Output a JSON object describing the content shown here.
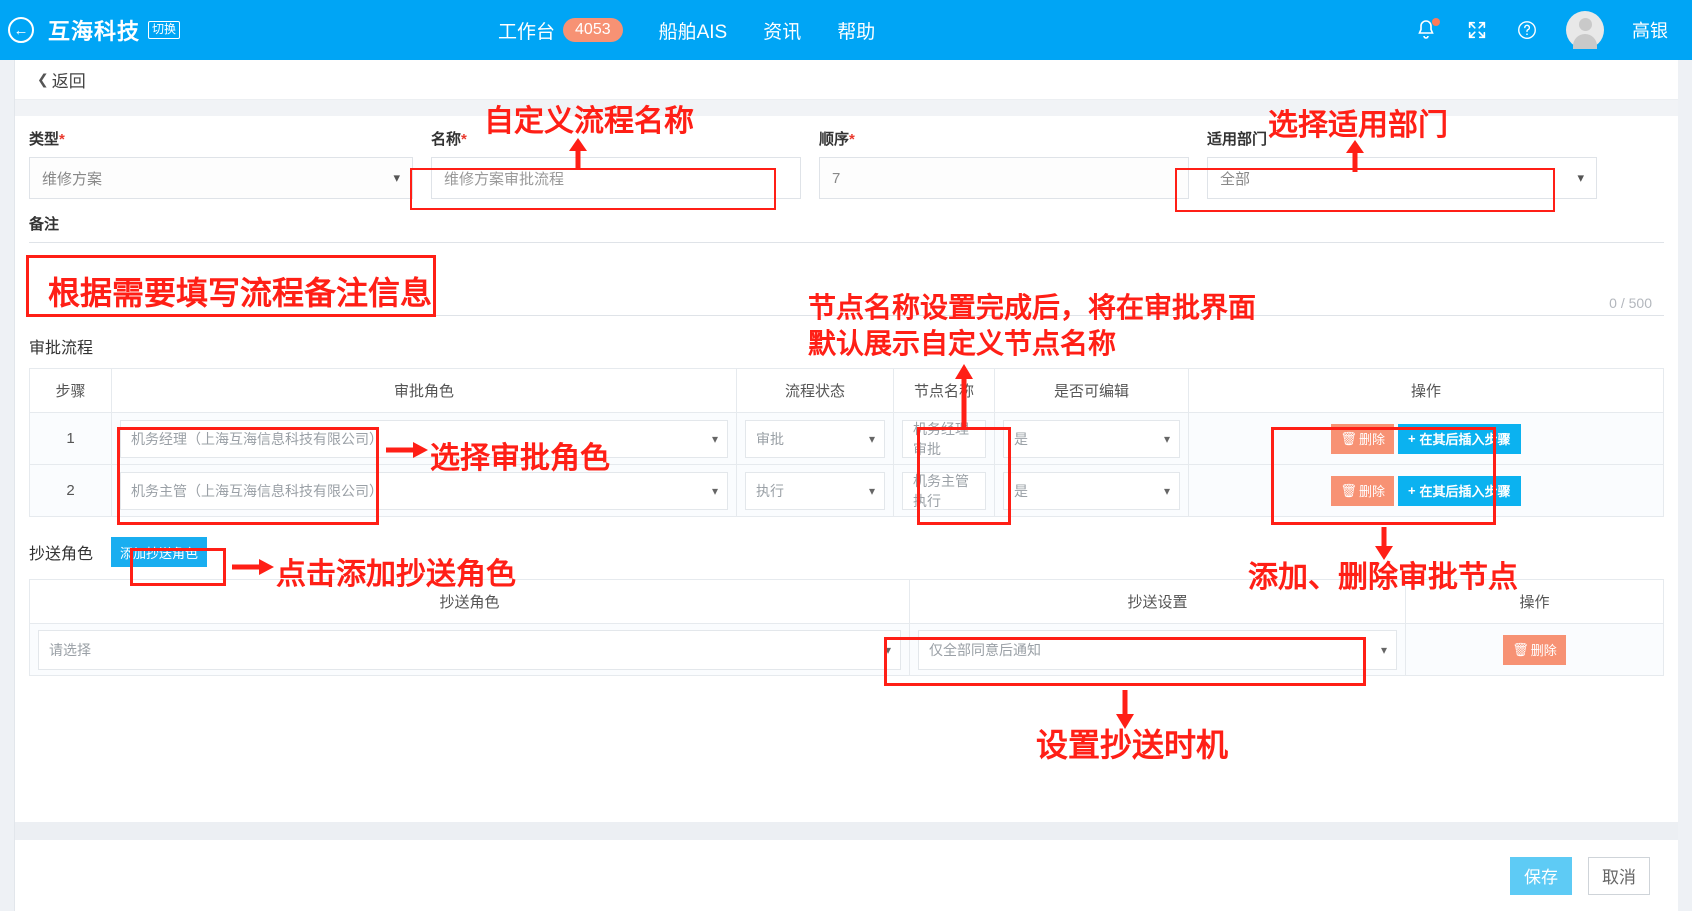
{
  "topbar": {
    "back_icon": "back-circle-arrow-icon",
    "brand": "互海科技",
    "switch_label": "切换",
    "nav": [
      {
        "label": "工作台",
        "badge": "4053"
      },
      {
        "label": "船舶AIS",
        "badge": ""
      },
      {
        "label": "资讯",
        "badge": ""
      },
      {
        "label": "帮助",
        "badge": ""
      }
    ],
    "bell_icon": "bell-icon",
    "fullscreen_icon": "fullscreen-icon",
    "help_icon": "question-circle-icon",
    "username": "高银",
    "bg_color": "#00a5f5",
    "badge_color": "#f79274"
  },
  "backbar": {
    "label": "返回"
  },
  "form": {
    "type": {
      "label": "类型",
      "required": "*",
      "value": "维修方案"
    },
    "name": {
      "label": "名称",
      "required": "*",
      "value": "维修方案审批流程"
    },
    "order": {
      "label": "顺序",
      "required": "*",
      "value": "7"
    },
    "department": {
      "label": "适用部门",
      "required": "",
      "value": "全部"
    },
    "remark": {
      "label": "备注",
      "value": "",
      "counter": "0 / 500"
    }
  },
  "approval": {
    "title": "审批流程",
    "columns": [
      "步骤",
      "审批角色",
      "流程状态",
      "节点名称",
      "是否可编辑",
      "操作"
    ],
    "rows": [
      {
        "step": "1",
        "role": "机务经理（上海互海信息科技有限公司）",
        "status": "审批",
        "node_name": "机务经理审批",
        "editable": "是",
        "delete_label": "删除",
        "insert_label": "在其后插入步骤"
      },
      {
        "step": "2",
        "role": "机务主管（上海互海信息科技有限公司）",
        "status": "执行",
        "node_name": "机务主管执行",
        "editable": "是",
        "delete_label": "删除",
        "insert_label": "在其后插入步骤"
      }
    ]
  },
  "cc": {
    "label": "抄送角色",
    "add_button": "添加抄送角色",
    "columns": [
      "抄送角色",
      "抄送设置",
      "操作"
    ],
    "rows": [
      {
        "role": "请选择",
        "setting": "仅全部同意后通知",
        "delete_label": "删除"
      }
    ]
  },
  "footer": {
    "save_label": "保存",
    "cancel_label": "取消"
  },
  "annotations": [
    {
      "id": "a1",
      "text": "自定义流程名称"
    },
    {
      "id": "a2",
      "text": "选择适用部门"
    },
    {
      "id": "a3",
      "text": "根据需要填写流程备注信息"
    },
    {
      "id": "a4",
      "text": "节点名称设置完成后，将在审批界面"
    },
    {
      "id": "a5",
      "text": "默认展示自定义节点名称"
    },
    {
      "id": "a6",
      "text": "选择审批角色"
    },
    {
      "id": "a7",
      "text": "添加、删除审批节点"
    },
    {
      "id": "a8",
      "text": "点击添加抄送角色"
    },
    {
      "id": "a9",
      "text": "设置抄送时机"
    }
  ],
  "colors": {
    "accent": "#00a5f5",
    "annotation": "#ff1f16",
    "danger": "#f79274",
    "primary_button": "#5ecbf5"
  }
}
